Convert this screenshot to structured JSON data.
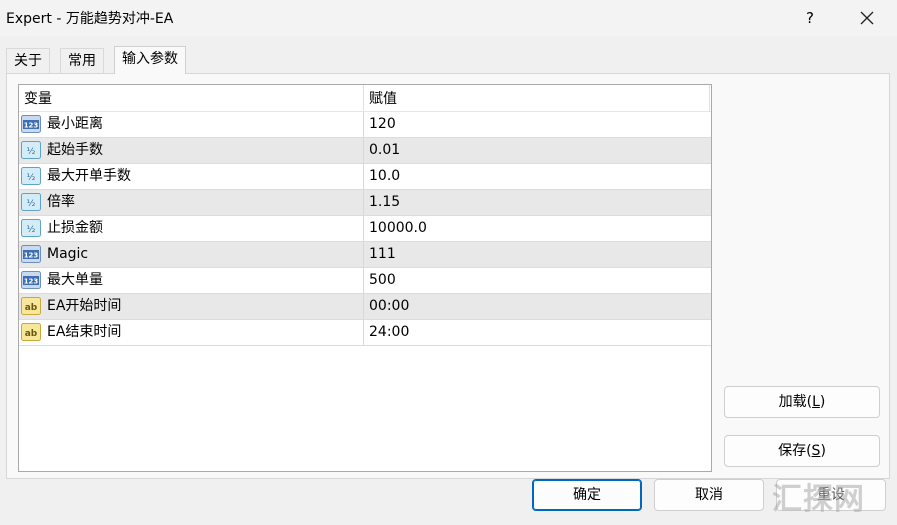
{
  "window": {
    "title": "Expert - 万能趋势对冲-EA",
    "help_label": "?"
  },
  "tabs": [
    {
      "label": "关于"
    },
    {
      "label": "常用"
    },
    {
      "label": "输入参数"
    }
  ],
  "grid": {
    "headers": {
      "variable": "变量",
      "value": "赋值"
    },
    "rows": [
      {
        "icon": "integer-icon",
        "name": "最小距离",
        "value": "120"
      },
      {
        "icon": "double-icon",
        "name": "起始手数",
        "value": "0.01"
      },
      {
        "icon": "double-icon",
        "name": "最大开单手数",
        "value": "10.0"
      },
      {
        "icon": "double-icon",
        "name": "倍率",
        "value": "1.15"
      },
      {
        "icon": "double-icon",
        "name": "止损金额",
        "value": "10000.0"
      },
      {
        "icon": "integer-icon",
        "name": "Magic",
        "value": "111"
      },
      {
        "icon": "integer-icon",
        "name": "最大单量",
        "value": "500"
      },
      {
        "icon": "string-icon",
        "name": "EA开始时间",
        "value": "00:00"
      },
      {
        "icon": "string-icon",
        "name": "EA结束时间",
        "value": "24:00"
      }
    ]
  },
  "buttons": {
    "load": {
      "label": "加载(",
      "key": "L",
      "tail": ")"
    },
    "save": {
      "label": "保存(",
      "key": "S",
      "tail": ")"
    },
    "ok": "确定",
    "cancel": "取消",
    "reset": "重设"
  },
  "watermark": "汇探网",
  "colors": {
    "accent": "#0067c0",
    "alt_row": "#e8e8e8"
  }
}
